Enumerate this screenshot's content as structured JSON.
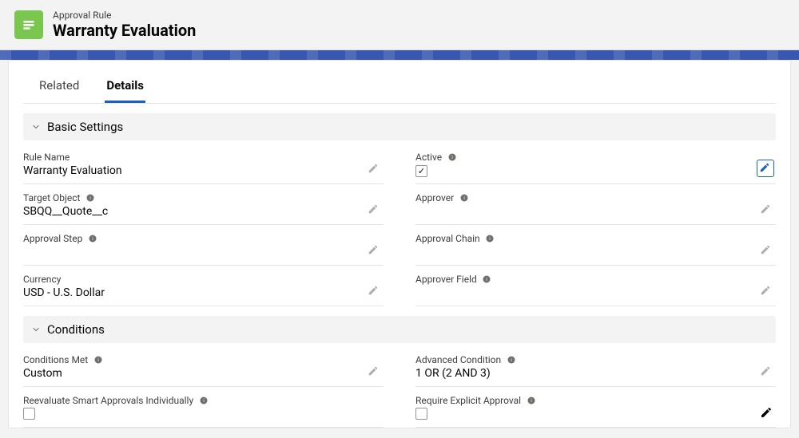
{
  "header": {
    "object_label": "Approval Rule",
    "record_name": "Warranty Evaluation"
  },
  "tabs": {
    "related": "Related",
    "details": "Details"
  },
  "sections": {
    "basic_settings": {
      "title": "Basic Settings",
      "fields": {
        "rule_name": {
          "label": "Rule Name",
          "value": "Warranty Evaluation"
        },
        "active": {
          "label": "Active",
          "checked": true
        },
        "target_object": {
          "label": "Target Object",
          "value": "SBQQ__Quote__c"
        },
        "approver": {
          "label": "Approver",
          "value": ""
        },
        "approval_step": {
          "label": "Approval Step",
          "value": ""
        },
        "approval_chain": {
          "label": "Approval Chain",
          "value": ""
        },
        "currency": {
          "label": "Currency",
          "value": "USD - U.S. Dollar"
        },
        "approver_field": {
          "label": "Approver Field",
          "value": ""
        }
      }
    },
    "conditions": {
      "title": "Conditions",
      "fields": {
        "conditions_met": {
          "label": "Conditions Met",
          "value": "Custom"
        },
        "advanced_condition": {
          "label": "Advanced Condition",
          "value": "1 OR (2 AND 3)"
        },
        "reevaluate": {
          "label": "Reevaluate Smart Approvals Individually",
          "checked": false
        },
        "require_explicit": {
          "label": "Require Explicit Approval",
          "checked": false
        }
      }
    }
  }
}
